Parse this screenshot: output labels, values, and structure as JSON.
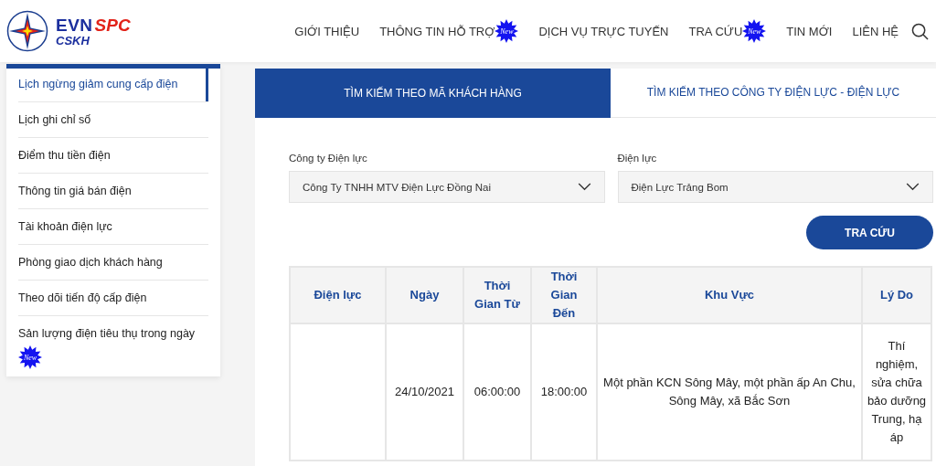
{
  "logo": {
    "brand": "EVN",
    "brand_accent": "SPC",
    "subtitle": "CSKH"
  },
  "nav": [
    {
      "label": "GIỚI THIỆU"
    },
    {
      "label": "THÔNG TIN HỖ TRỢ",
      "badge": "New"
    },
    {
      "label": "DỊCH VỤ TRỰC TUYẾN"
    },
    {
      "label": "TRA CỨU",
      "badge": "New"
    },
    {
      "label": "TIN MỚI"
    },
    {
      "label": "LIÊN HỆ"
    }
  ],
  "sidebar": {
    "items": [
      {
        "label": "Lịch ngừng giảm cung cấp điện",
        "selected": true
      },
      {
        "label": "Lịch ghi chỉ số",
        "selected": false
      },
      {
        "label": "Điểm thu tiền điện",
        "selected": false
      },
      {
        "label": "Thông tin giá bán điện",
        "selected": false
      },
      {
        "label": "Tài khoản điện lực",
        "selected": false
      },
      {
        "label": "Phòng giao dịch khách hàng",
        "selected": false
      },
      {
        "label": "Theo dõi tiến độ cấp điện",
        "selected": false
      },
      {
        "label": "Sản lượng điện tiêu thụ trong ngày",
        "selected": false,
        "badge": "New"
      }
    ]
  },
  "tabs": [
    {
      "label": "TÌM KIẾM THEO MÃ KHÁCH HÀNG",
      "selected": false
    },
    {
      "label": "TÌM KIẾM THEO CÔNG TY ĐIỆN LỰC - ĐIỆN LỰC",
      "selected": true
    }
  ],
  "form": {
    "fields": [
      {
        "label": "Công ty Điện lực",
        "value": "Công Ty TNHH MTV Điện Lực Đồng Nai"
      },
      {
        "label": "Điện lực",
        "value": "Điện Lực Trảng Bom"
      }
    ],
    "button": "TRA CỨU"
  },
  "table": {
    "columns": [
      "Điện lực",
      "Ngày",
      "Thời Gian Từ",
      "Thời Gian Đến",
      "Khu Vực",
      "Lý Do"
    ],
    "rows": [
      {
        "cells": [
          null,
          "24/10/2021",
          "06:00:00",
          "18:00:00",
          "Một phần KCN Sông Mây, một phần ấp An Chu, Sông Mây, xã Bắc Sơn",
          "Thí nghiệm, sửa chữa bảo dưỡng Trung, hạ áp"
        ]
      }
    ]
  }
}
